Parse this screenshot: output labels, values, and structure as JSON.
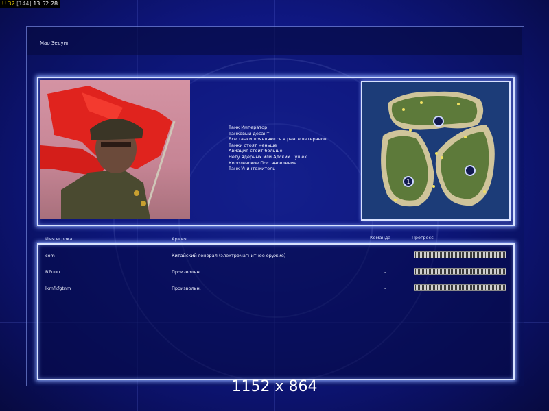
{
  "status": {
    "u_label": "U 32",
    "count": "[144]",
    "time": "13:52:28"
  },
  "title": "Мао Зедунг",
  "rules": [
    "Танк Император",
    "Танковый десант",
    "Все танки появляются в ранге ветеранов",
    "Танки стоят меньше",
    "Авиация стоит больше",
    "Нету ядерных или Адских Пушек",
    "Королевское Постановление",
    "Танк Уничтожитель"
  ],
  "table": {
    "headers": {
      "player": "Имя игрока",
      "army": "Армия",
      "team": "Команда",
      "progress": "Прогресс"
    },
    "rows": [
      {
        "player": "com",
        "army": "Китайский генерал (электромагнитное оружие)",
        "team": "-",
        "progress": 1.0
      },
      {
        "player": "BZuuu",
        "army": "Произвольн.",
        "team": "-",
        "progress": 1.0
      },
      {
        "player": "lkmfkfgtnm",
        "army": "Произвольн.",
        "team": "-",
        "progress": 1.0
      }
    ]
  },
  "map": {
    "start_position_label": "1"
  },
  "resolution": "1152 x 864",
  "colors": {
    "accent": "#d8e2ff",
    "background": "#10198a",
    "flag": "#e0231e"
  }
}
